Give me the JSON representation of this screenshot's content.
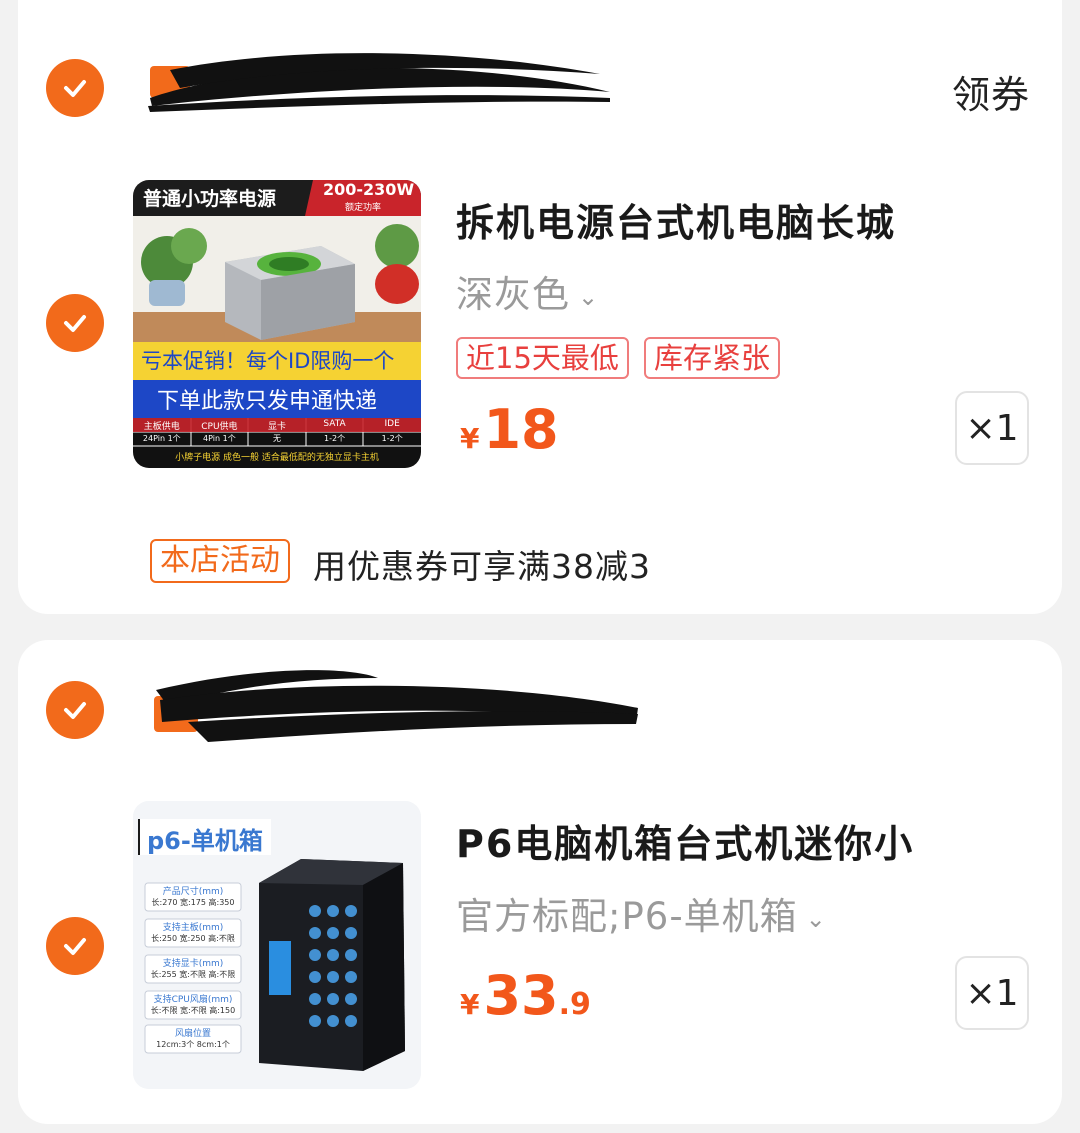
{
  "shops": [
    {
      "shop_name": "",
      "coupon_label": "领券",
      "item": {
        "title": "拆机电源台式机电脑长城",
        "variant": "深灰色",
        "tags": [
          "近15天最低",
          "库存紧张"
        ],
        "currency": "¥",
        "price_int": "18",
        "price_dec": "",
        "quantity": "×1",
        "thumb_text": {
          "top_left": "普通小功率电源",
          "top_right": "200-230W",
          "top_right_sub": "额定功率",
          "band_yellow": "亏本促销！每个ID限购一个",
          "band_blue": "下单此款只发申通快递",
          "spec_headers": [
            "主板供电",
            "CPU供电",
            "显卡",
            "SATA",
            "IDE"
          ],
          "spec_values": [
            "24Pin 1个",
            "4Pin 1个",
            "无",
            "1-2个",
            "1-2个"
          ],
          "footer": "小牌子电源   成色一般   适合最低配的无独立显卡主机"
        }
      },
      "promo": {
        "tag": "本店活动",
        "text": "用优惠券可享满38减3"
      }
    },
    {
      "shop_name": "",
      "item": {
        "title": "P6电脑机箱台式机迷你小",
        "variant": "官方标配;P6-单机箱",
        "currency": "¥",
        "price_int": "33",
        "price_dec": ".9",
        "quantity": "×1",
        "thumb_text": {
          "title": "p6-单机箱",
          "specs": [
            {
              "label": "产品尺寸(mm)",
              "value": "长:270 宽:175 高:350"
            },
            {
              "label": "支持主板(mm)",
              "value": "长:250 宽:250 高:不限"
            },
            {
              "label": "支持显卡(mm)",
              "value": "长:255 宽:不限 高:不限"
            },
            {
              "label": "支持CPU风扇(mm)",
              "value": "长:不限 宽:不限 高:150"
            },
            {
              "label": "风扇位置",
              "value": "12cm:3个 8cm:1个"
            }
          ]
        }
      }
    }
  ],
  "colors": {
    "accent": "#f26a1b",
    "tag_red": "#e8403e",
    "background": "#f2f2f2"
  },
  "icons": [
    "checkmark-icon",
    "chevron-down-icon"
  ]
}
